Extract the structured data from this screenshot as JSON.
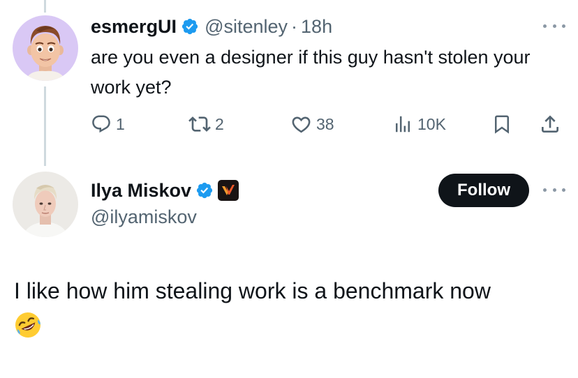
{
  "tweet1": {
    "display_name": "esmergUI",
    "handle": "@sitenley",
    "separator": "·",
    "time": "18h",
    "text": "are you even a designer if this guy hasn't stolen your work yet?",
    "actions": {
      "replies": "1",
      "reposts": "2",
      "likes": "38",
      "views": "10K"
    },
    "icons": [
      "reply-icon",
      "repost-icon",
      "like-icon",
      "views-icon",
      "bookmark-icon",
      "share-icon"
    ]
  },
  "tweet2": {
    "display_name": "Ilya Miskov",
    "handle": "@ilyamiskov",
    "follow_label": "Follow",
    "text": "I like how him stealing work is a benchmark now",
    "emoji": "rolling-on-floor-laughing"
  },
  "colors": {
    "text": "#0f1419",
    "muted": "#536471",
    "verified": "#1d9bf0",
    "follow_bg": "#0f1419",
    "thread_line": "#cfd9de"
  }
}
